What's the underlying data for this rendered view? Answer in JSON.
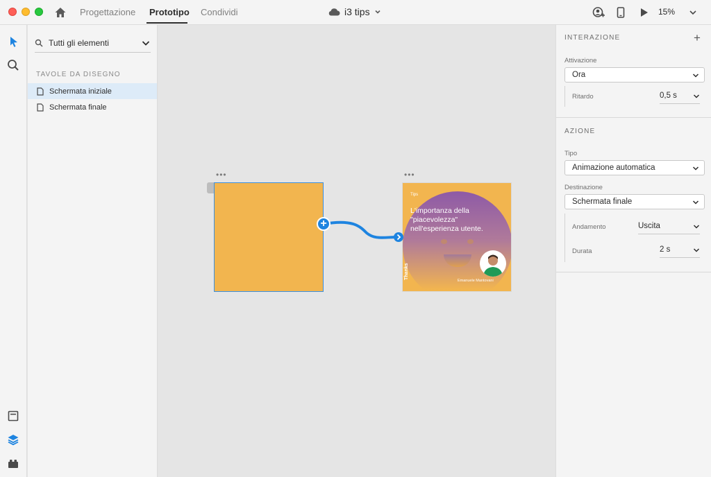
{
  "window": {
    "tabs": [
      {
        "label": "Progettazione",
        "active": false
      },
      {
        "label": "Prototipo",
        "active": true
      },
      {
        "label": "Condividi",
        "active": false
      }
    ],
    "document_title": "i3 tips",
    "zoom": "15%"
  },
  "layers_panel": {
    "filter_label": "Tutti gli elementi",
    "section_title": "TAVOLE DA DISEGNO",
    "artboards": [
      {
        "label": "Schermata iniziale",
        "selected": true
      },
      {
        "label": "Schermata finale",
        "selected": false
      }
    ]
  },
  "canvas": {
    "artboard_dots": "•••",
    "plus_handle": "+",
    "artboard_final": {
      "tag": "Tips",
      "headline": "L'importanza della \"piacevolezza\" nell'esperienza utente.",
      "side_text": "Thanks",
      "author": "Emanuele Mantovani",
      "background_color": "#f2b54f"
    }
  },
  "inspector": {
    "interaction_title": "INTERAZIONE",
    "add_label": "+",
    "trigger_label": "Attivazione",
    "trigger_value": "Ora",
    "delay_label": "Ritardo",
    "delay_value": "0,5 s",
    "action_title": "AZIONE",
    "type_label": "Tipo",
    "type_value": "Animazione automatica",
    "destination_label": "Destinazione",
    "destination_value": "Schermata finale",
    "easing_label": "Andamento",
    "easing_value": "Uscita",
    "duration_label": "Durata",
    "duration_value": "2 s"
  },
  "colors": {
    "accent": "#1e84e0",
    "artboard": "#f2b54f"
  }
}
